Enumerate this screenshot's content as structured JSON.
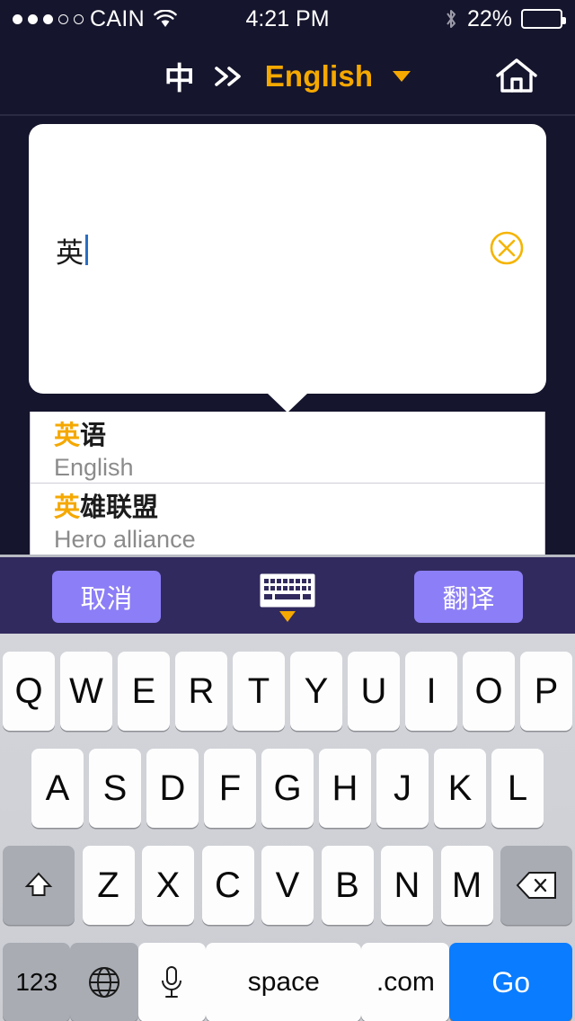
{
  "statusbar": {
    "carrier": "CAIN",
    "signal_dots_filled": 3,
    "signal_dots_total": 5,
    "wifi_icon": "wifi-icon",
    "time": "4:21 PM",
    "bluetooth_icon": "bluetooth-icon",
    "battery_percent": "22%",
    "battery_level": 22
  },
  "header": {
    "source_language": "中",
    "arrow_icon": "double-chevron-right-icon",
    "target_language": "English",
    "dropdown_icon": "chevron-down-icon",
    "home_icon": "home-icon"
  },
  "input_card": {
    "text": "英",
    "placeholder": "",
    "clear_icon": "clear-circle-x-icon"
  },
  "suggestions": [
    {
      "zh_highlight": "英",
      "zh_rest": "语",
      "en": "English"
    },
    {
      "zh_highlight": "英",
      "zh_rest": "雄联盟",
      "en": "Hero alliance"
    }
  ],
  "toolbar": {
    "cancel_label": "取消",
    "keyboard_icon": "keyboard-icon",
    "translate_label": "翻译"
  },
  "keyboard": {
    "row1": [
      "Q",
      "W",
      "E",
      "R",
      "T",
      "Y",
      "U",
      "I",
      "O",
      "P"
    ],
    "row2": [
      "A",
      "S",
      "D",
      "F",
      "G",
      "H",
      "J",
      "K",
      "L"
    ],
    "row3_letters": [
      "Z",
      "X",
      "C",
      "V",
      "B",
      "N",
      "M"
    ],
    "shift_icon": "shift-up-arrow-icon",
    "backspace_icon": "backspace-delete-icon",
    "numbers_label": "123",
    "globe_icon": "globe-language-icon",
    "mic_icon": "microphone-icon",
    "space_label": "space",
    "dotcom_label": ".com",
    "go_label": "Go"
  },
  "colors": {
    "background": "#15152d",
    "accent_yellow": "#f5a800",
    "toolbar_bg": "#312a5e",
    "toolbar_button": "#8c7ef6",
    "go_blue": "#0a7cff",
    "keyboard_bg": "#d3d5da"
  }
}
